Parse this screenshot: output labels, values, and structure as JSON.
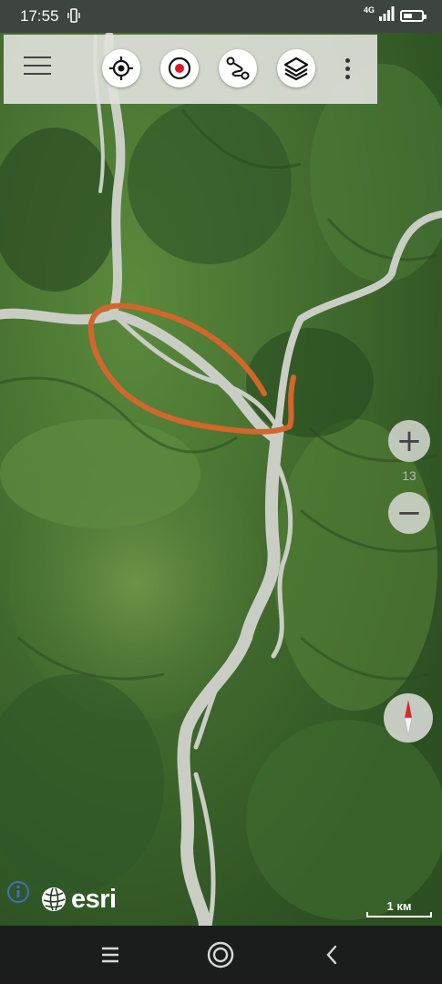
{
  "status_bar": {
    "time": "17:55",
    "network": "4G",
    "vibrate_icon": "vibrate-icon",
    "signal_icon": "signal-icon",
    "battery_icon": "battery-icon",
    "battery_level": 0.5
  },
  "toolbar": {
    "menu_icon": "hamburger-menu-icon",
    "buttons": [
      {
        "name": "my-location-button",
        "icon": "crosshair-icon"
      },
      {
        "name": "record-track-button",
        "icon": "record-icon",
        "color": "#e0142a"
      },
      {
        "name": "route-button",
        "icon": "route-icon"
      },
      {
        "name": "layers-button",
        "icon": "layers-icon"
      }
    ],
    "overflow_icon": "more-vertical-icon"
  },
  "map": {
    "basemap": "satellite imagery",
    "drawn_track_color": "#d2662c",
    "river_color": "#c9cdc4",
    "terrain_colors": [
      "#3f6a2e",
      "#2f5424",
      "#57843b",
      "#6a8f49"
    ]
  },
  "zoom_controls": {
    "zoom_in_label": "+",
    "zoom_out_label": "−",
    "zoom_level": "13"
  },
  "compass": {
    "icon": "compass-icon",
    "north_color": "#d8262a"
  },
  "attribution": {
    "info_icon": "info-icon",
    "logo_text": "esri",
    "logo_icon": "esri-globe-icon"
  },
  "scale_bar": {
    "label": "1 км"
  },
  "nav_bar": {
    "menu_icon": "recent-apps-icon",
    "home_icon": "home-icon",
    "back_icon": "back-icon"
  }
}
